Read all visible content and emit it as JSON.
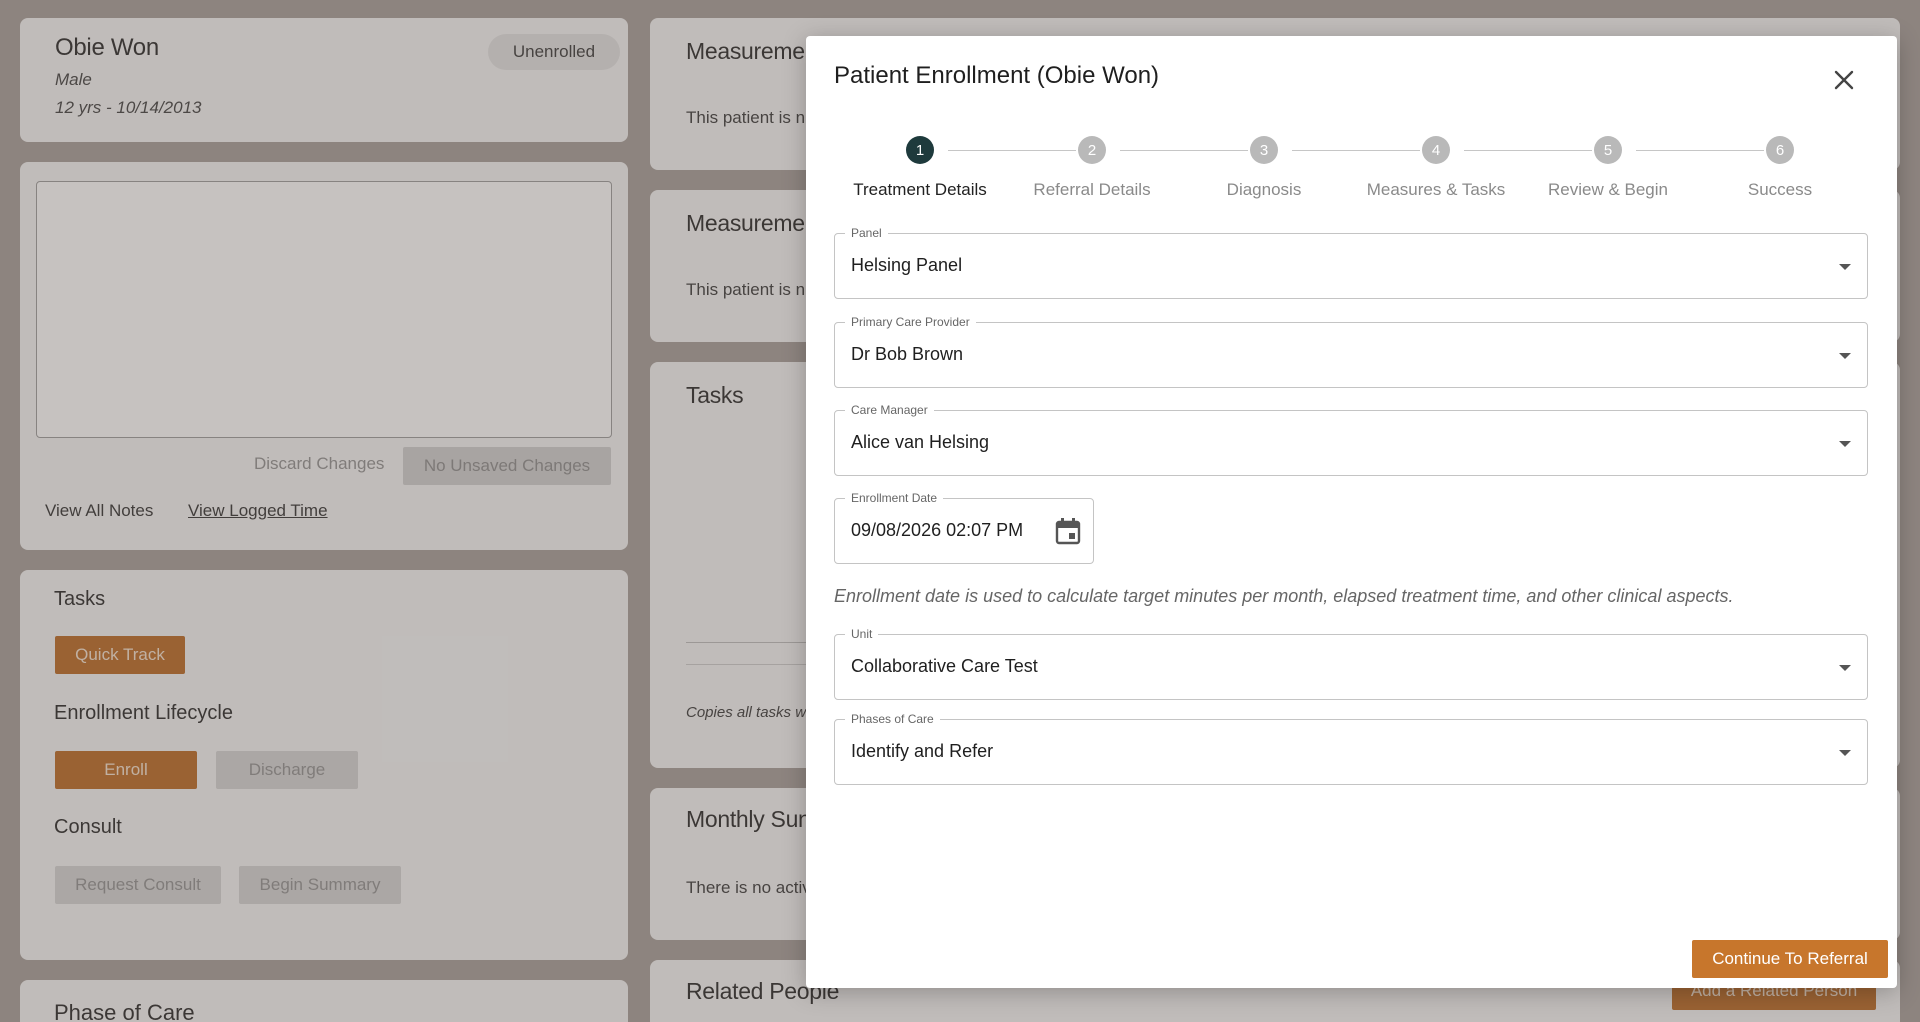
{
  "patient": {
    "name": "Obie Won",
    "sex": "Male",
    "age_dob": "12 yrs - 10/14/2013",
    "status_badge": "Unenrolled"
  },
  "notes": {
    "discard_label": "Discard Changes",
    "no_unsaved_label": "No Unsaved Changes",
    "view_all_notes": "View All Notes",
    "view_logged_time": "View Logged Time"
  },
  "left_panel": {
    "tasks_heading": "Tasks",
    "quick_track": "Quick Track",
    "enrollment_heading": "Enrollment Lifecycle",
    "enroll": "Enroll",
    "discharge": "Discharge",
    "consult_heading": "Consult",
    "request_consult": "Request Consult",
    "begin_summary": "Begin Summary",
    "phase_heading": "Phase of Care"
  },
  "right_panel": {
    "measurements_1_heading": "Measuremen",
    "measurements_1_text": "This patient is n",
    "measurements_2_heading": "Measuremen",
    "measurements_2_text": "This patient is n",
    "tasks_heading": "Tasks",
    "copies_text": "Copies all tasks w",
    "monthly_heading": "Monthly Sun",
    "monthly_text": "There is no activ",
    "related_heading": "Related People",
    "add_related": "Add a Related Person"
  },
  "modal": {
    "title": "Patient Enrollment (Obie Won)",
    "close_icon": "close-icon",
    "steps": [
      {
        "num": "1",
        "label": "Treatment Details"
      },
      {
        "num": "2",
        "label": "Referral Details"
      },
      {
        "num": "3",
        "label": "Diagnosis"
      },
      {
        "num": "4",
        "label": "Measures & Tasks"
      },
      {
        "num": "5",
        "label": "Review & Begin"
      },
      {
        "num": "6",
        "label": "Success"
      }
    ],
    "active_step": 1,
    "fields": {
      "panel": {
        "label": "Panel",
        "value": "Helsing Panel"
      },
      "pcp": {
        "label": "Primary Care Provider",
        "value": "Dr Bob Brown"
      },
      "care_manager": {
        "label": "Care Manager",
        "value": "Alice van Helsing"
      },
      "enrollment_date": {
        "label": "Enrollment Date",
        "value": "09/08/2026 02:07 PM"
      },
      "unit": {
        "label": "Unit",
        "value": "Collaborative Care Test"
      },
      "phases": {
        "label": "Phases of Care",
        "value": "Identify and Refer"
      }
    },
    "hint": "Enrollment date is used to calculate target minutes per month, elapsed treatment time, and other clinical aspects.",
    "continue_label": "Continue To Referral"
  },
  "colors": {
    "accent": "#c7762c",
    "active_step": "#1e3a3c"
  }
}
